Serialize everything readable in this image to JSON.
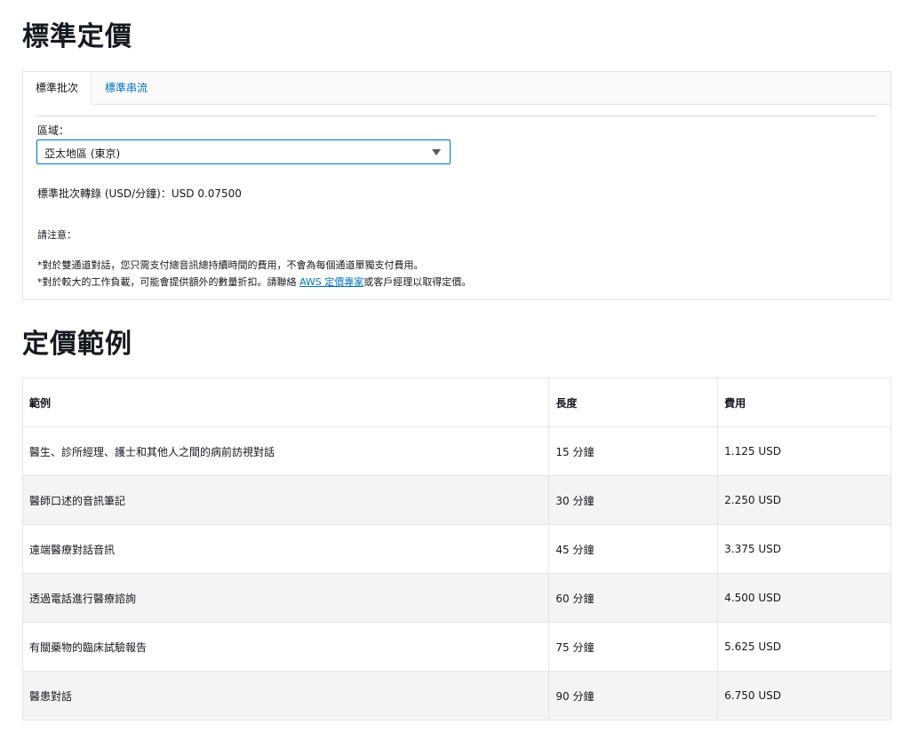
{
  "page": {
    "title": "標準定價",
    "examples_title": "定價範例"
  },
  "tabs": [
    {
      "label": "標準批次"
    },
    {
      "label": "標準串流"
    }
  ],
  "region": {
    "label": "區域：",
    "selected": "亞太地區 (東京)"
  },
  "rate": {
    "text": "標準批次轉錄 (USD/分鐘)：USD 0.07500"
  },
  "notes": {
    "title": "請注意：",
    "line1": "*對於雙通道對話，您只需支付總音訊總持續時間的費用，不會為每個通道單獨支付費用。",
    "line2_prefix": "*對於較大的工作負載，可能會提供額外的數量折扣。請聯絡 ",
    "line2_link": "AWS 定價專家",
    "line2_suffix": "或客戶經理以取得定價。"
  },
  "table": {
    "headers": [
      "範例",
      "長度",
      "費用"
    ],
    "rows": [
      [
        "醫生、診所經理、護士和其他人之間的病前訪視對話",
        "15 分鐘",
        "1.125 USD"
      ],
      [
        "醫師口述的音訊筆記",
        "30 分鐘",
        "2.250 USD"
      ],
      [
        "遠端醫療對話音訊",
        "45 分鐘",
        "3.375 USD"
      ],
      [
        "透過電話進行醫療諮詢",
        "60 分鐘",
        "4.500 USD"
      ],
      [
        "有關藥物的臨床試驗報告",
        "75 分鐘",
        "5.625 USD"
      ],
      [
        "醫患對話",
        "90 分鐘",
        "6.750 USD"
      ]
    ]
  },
  "colors": {
    "link": "#0073bb",
    "text": "#16191f",
    "border": "#e6e6e6"
  }
}
